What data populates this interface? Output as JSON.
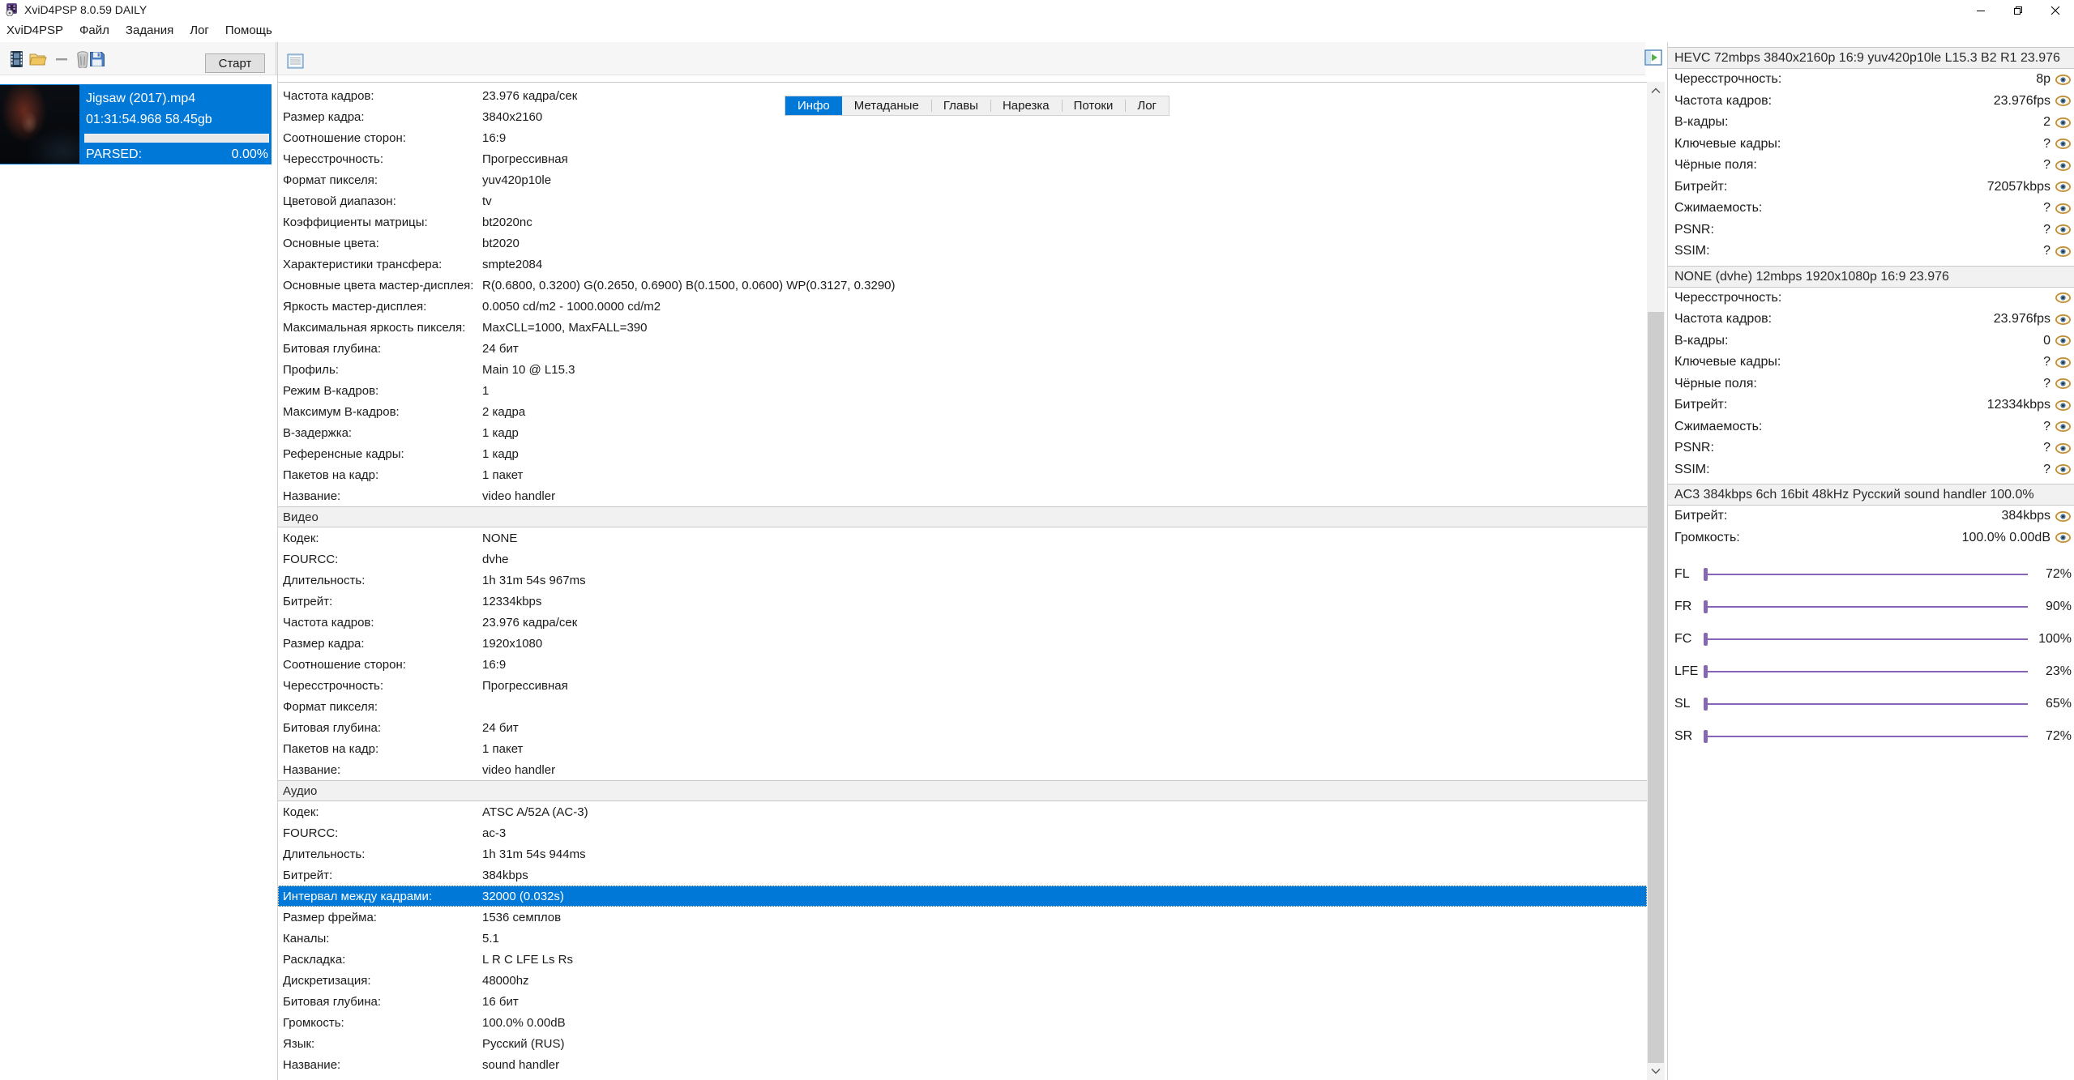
{
  "window": {
    "title": "XviD4PSP 8.0.59 DAILY"
  },
  "menu": {
    "items": [
      "XviD4PSP",
      "Файл",
      "Задания",
      "Лог",
      "Помощь"
    ]
  },
  "toolbar": {
    "start_label": "Старт",
    "icons": [
      "video-file-icon",
      "open-folder-icon",
      "remove-item-icon",
      "delete-icon",
      "save-icon"
    ],
    "log_panel_icon": "task-log-icon",
    "toggle_panel_icon": "toggle-right-panel-icon",
    "row_action_icon": "eye-preview-icon"
  },
  "tabs": {
    "items": [
      {
        "label": "Инфо",
        "selected": true
      },
      {
        "label": "Метаданые",
        "selected": false
      },
      {
        "label": "Главы",
        "selected": false
      },
      {
        "label": "Нарезка",
        "selected": false
      },
      {
        "label": "Потоки",
        "selected": false
      },
      {
        "label": "Лог",
        "selected": false
      }
    ]
  },
  "file_item": {
    "name": "Jigsaw (2017).mp4",
    "duration_size": "01:31:54.968 58.45gb",
    "status_label": "PARSED:",
    "progress": "0.00%"
  },
  "info_table": {
    "sections": [
      {
        "header": null,
        "rows": [
          {
            "l": "Частота кадров:",
            "v": "23.976 кадра/сек"
          },
          {
            "l": "Размер кадра:",
            "v": "3840x2160"
          },
          {
            "l": "Соотношение сторон:",
            "v": "16:9"
          },
          {
            "l": "Чересстрочность:",
            "v": "Прогрессивная"
          },
          {
            "l": "Формат пикселя:",
            "v": "yuv420p10le"
          },
          {
            "l": "Цветовой диапазон:",
            "v": "tv"
          },
          {
            "l": "Коэффициенты матрицы:",
            "v": "bt2020nc"
          },
          {
            "l": "Основные цвета:",
            "v": "bt2020"
          },
          {
            "l": "Характеристики трансфера:",
            "v": "smpte2084"
          },
          {
            "l": "Основные цвета мастер-дисплея:",
            "v": "R(0.6800, 0.3200) G(0.2650, 0.6900) B(0.1500, 0.0600) WP(0.3127, 0.3290)"
          },
          {
            "l": "Яркость мастер-дисплея:",
            "v": "0.0050 cd/m2 - 1000.0000 cd/m2"
          },
          {
            "l": "Максимальная яркость пикселя:",
            "v": "MaxCLL=1000, MaxFALL=390"
          },
          {
            "l": "Битовая глубина:",
            "v": "24 бит"
          },
          {
            "l": "Профиль:",
            "v": "Main 10 @ L15.3"
          },
          {
            "l": "Режим B-кадров:",
            "v": "1"
          },
          {
            "l": "Максимум B-кадров:",
            "v": "2 кадра"
          },
          {
            "l": "B-задержка:",
            "v": "1 кадр"
          },
          {
            "l": "Референсные кадры:",
            "v": "1 кадр"
          },
          {
            "l": "Пакетов на кадр:",
            "v": "1 пакет"
          },
          {
            "l": "Название:",
            "v": "video handler"
          }
        ]
      },
      {
        "header": "Видео",
        "rows": [
          {
            "l": "Кодек:",
            "v": "NONE"
          },
          {
            "l": "FOURCC:",
            "v": "dvhe"
          },
          {
            "l": "Длительность:",
            "v": "1h 31m 54s 967ms"
          },
          {
            "l": "Битрейт:",
            "v": "12334kbps"
          },
          {
            "l": "Частота кадров:",
            "v": "23.976 кадра/сек"
          },
          {
            "l": "Размер кадра:",
            "v": "1920x1080"
          },
          {
            "l": "Соотношение сторон:",
            "v": "16:9"
          },
          {
            "l": "Чересстрочность:",
            "v": "Прогрессивная"
          },
          {
            "l": "Формат пикселя:",
            "v": ""
          },
          {
            "l": "Битовая глубина:",
            "v": "24 бит"
          },
          {
            "l": "Пакетов на кадр:",
            "v": "1 пакет"
          },
          {
            "l": "Название:",
            "v": "video handler"
          }
        ]
      },
      {
        "header": "Аудио",
        "rows": [
          {
            "l": "Кодек:",
            "v": "ATSC A/52A (AC-3)"
          },
          {
            "l": "FOURCC:",
            "v": "ac-3"
          },
          {
            "l": "Длительность:",
            "v": "1h 31m 54s 944ms"
          },
          {
            "l": "Битрейт:",
            "v": "384kbps"
          },
          {
            "l": "Интервал между кадрами:",
            "v": "32000 (0.032s)",
            "selected": true
          },
          {
            "l": "Размер фрейма:",
            "v": "1536 семплов"
          },
          {
            "l": "Каналы:",
            "v": "5.1"
          },
          {
            "l": "Раскладка:",
            "v": "L R C LFE Ls Rs"
          },
          {
            "l": "Дискретизация:",
            "v": "48000hz"
          },
          {
            "l": "Битовая глубина:",
            "v": "16 бит"
          },
          {
            "l": "Громкость:",
            "v": "100.0% 0.00dB"
          },
          {
            "l": "Язык:",
            "v": "Русский (RUS)"
          },
          {
            "l": "Название:",
            "v": "sound handler"
          }
        ]
      }
    ]
  },
  "right_panel": {
    "sections": [
      {
        "title": "HEVC 72mbps 3840x2160p 16:9 yuv420p10le L15.3 B2 R1 23.976",
        "rows": [
          {
            "l": "Чересстрочность:",
            "v": "8p"
          },
          {
            "l": "Частота кадров:",
            "v": "23.976fps"
          },
          {
            "l": "B-кадры:",
            "v": "2"
          },
          {
            "l": "Ключевые кадры:",
            "v": "?"
          },
          {
            "l": "Чёрные поля:",
            "v": "?"
          },
          {
            "l": "Битрейт:",
            "v": "72057kbps"
          },
          {
            "l": "Сжимаемость:",
            "v": "?"
          },
          {
            "l": "PSNR:",
            "v": "?"
          },
          {
            "l": "SSIM:",
            "v": "?"
          }
        ]
      },
      {
        "title": "NONE (dvhe) 12mbps 1920x1080p 16:9 23.976",
        "rows": [
          {
            "l": "Чересстрочность:",
            "v": ""
          },
          {
            "l": "Частота кадров:",
            "v": "23.976fps"
          },
          {
            "l": "B-кадры:",
            "v": "0"
          },
          {
            "l": "Ключевые кадры:",
            "v": "?"
          },
          {
            "l": "Чёрные поля:",
            "v": "?"
          },
          {
            "l": "Битрейт:",
            "v": "12334kbps"
          },
          {
            "l": "Сжимаемость:",
            "v": "?"
          },
          {
            "l": "PSNR:",
            "v": "?"
          },
          {
            "l": "SSIM:",
            "v": "?"
          }
        ]
      },
      {
        "title": "AC3 384kbps 6ch 16bit 48kHz Русский sound handler 100.0%",
        "rows": [
          {
            "l": "Битрейт:",
            "v": "384kbps"
          },
          {
            "l": "Громкость:",
            "v": "100.0% 0.00dB"
          }
        ],
        "sliders": [
          {
            "channel": "FL",
            "percent": "72%"
          },
          {
            "channel": "FR",
            "percent": "90%"
          },
          {
            "channel": "FC",
            "percent": "100%"
          },
          {
            "channel": "LFE",
            "percent": "23%"
          },
          {
            "channel": "SL",
            "percent": "65%"
          },
          {
            "channel": "SR",
            "percent": "72%"
          }
        ]
      }
    ]
  },
  "colors": {
    "accent": "#0078d7",
    "slider_purple": "#8764b8",
    "eye_gold": "#c08a2e",
    "eye_iris": "#4a7aa0"
  }
}
